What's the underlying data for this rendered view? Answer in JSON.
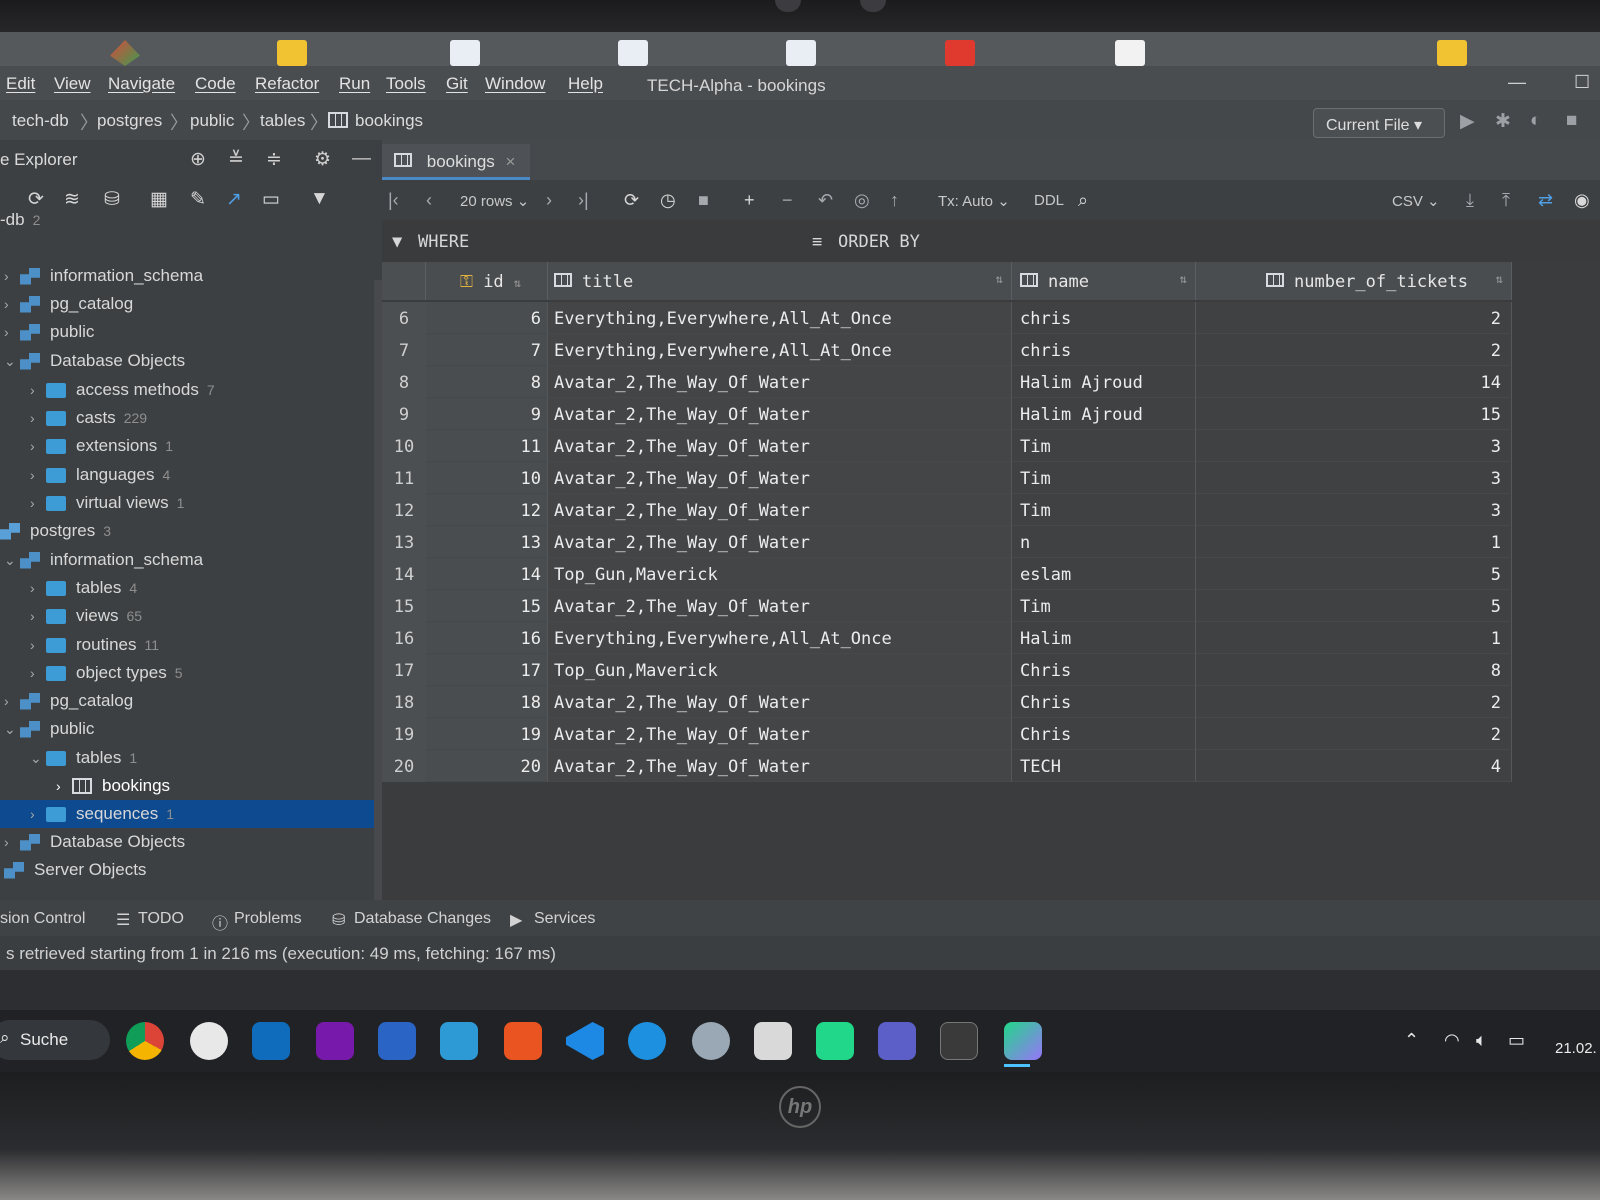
{
  "window": {
    "title": "TECH-Alpha - bookings",
    "minimize": "—",
    "maximize": "☐"
  },
  "menu": [
    "Edit",
    "View",
    "Navigate",
    "Code",
    "Refactor",
    "Run",
    "Tools",
    "Git",
    "Window",
    "Help"
  ],
  "breadcrumb": [
    "tech-db",
    "postgres",
    "public",
    "tables",
    "bookings"
  ],
  "run_config": "Current File",
  "explorer": {
    "title": "e Explorer",
    "tree": [
      {
        "label": "-db",
        "count": "2",
        "icon": "db-icon"
      },
      {
        "label": "information_schema",
        "count": "",
        "icon": "schema-icon"
      },
      {
        "label": "pg_catalog",
        "count": "",
        "icon": "schema-icon"
      },
      {
        "label": "public",
        "count": "",
        "icon": "schema-icon"
      },
      {
        "label": "Database Objects",
        "count": "",
        "icon": "schema-icon"
      },
      {
        "label": "access methods",
        "count": "7",
        "icon": "folder-icon"
      },
      {
        "label": "casts",
        "count": "229",
        "icon": "folder-icon"
      },
      {
        "label": "extensions",
        "count": "1",
        "icon": "folder-icon"
      },
      {
        "label": "languages",
        "count": "4",
        "icon": "folder-icon"
      },
      {
        "label": "virtual views",
        "count": "1",
        "icon": "folder-icon"
      },
      {
        "label": "postgres",
        "count": "3",
        "icon": "db-icon"
      },
      {
        "label": "information_schema",
        "count": "",
        "icon": "schema-icon"
      },
      {
        "label": "tables",
        "count": "4",
        "icon": "folder-icon"
      },
      {
        "label": "views",
        "count": "65",
        "icon": "folder-icon"
      },
      {
        "label": "routines",
        "count": "11",
        "icon": "folder-icon"
      },
      {
        "label": "object types",
        "count": "5",
        "icon": "folder-icon"
      },
      {
        "label": "pg_catalog",
        "count": "",
        "icon": "schema-icon"
      },
      {
        "label": "public",
        "count": "",
        "icon": "schema-icon"
      },
      {
        "label": "tables",
        "count": "1",
        "icon": "folder-icon"
      },
      {
        "label": "bookings",
        "count": "",
        "icon": "table-icon"
      },
      {
        "label": "sequences",
        "count": "1",
        "icon": "folder-icon"
      },
      {
        "label": "Database Objects",
        "count": "",
        "icon": "schema-icon"
      },
      {
        "label": "Server Objects",
        "count": "",
        "icon": "schema-icon"
      }
    ]
  },
  "editor": {
    "tab_label": "bookings",
    "page_size": "20 rows",
    "tx_mode": "Tx: Auto",
    "ddl_label": "DDL",
    "export_format": "CSV",
    "where_label": "WHERE",
    "order_label": "ORDER BY",
    "columns": [
      "id",
      "title",
      "name",
      "number_of_tickets"
    ],
    "rows": [
      {
        "n": "6",
        "id": "6",
        "title": "Everything,Everywhere,All_At_Once",
        "name": "chris",
        "tickets": "2"
      },
      {
        "n": "7",
        "id": "7",
        "title": "Everything,Everywhere,All_At_Once",
        "name": "chris",
        "tickets": "2"
      },
      {
        "n": "8",
        "id": "8",
        "title": "Avatar_2,The_Way_Of_Water",
        "name": "Halim Ajroud",
        "tickets": "14"
      },
      {
        "n": "9",
        "id": "9",
        "title": "Avatar_2,The_Way_Of_Water",
        "name": "Halim Ajroud",
        "tickets": "15"
      },
      {
        "n": "10",
        "id": "11",
        "title": "Avatar_2,The_Way_Of_Water",
        "name": "Tim",
        "tickets": "3"
      },
      {
        "n": "11",
        "id": "10",
        "title": "Avatar_2,The_Way_Of_Water",
        "name": "Tim",
        "tickets": "3"
      },
      {
        "n": "12",
        "id": "12",
        "title": "Avatar_2,The_Way_Of_Water",
        "name": "Tim",
        "tickets": "3"
      },
      {
        "n": "13",
        "id": "13",
        "title": "Avatar_2,The_Way_Of_Water",
        "name": "n",
        "tickets": "1"
      },
      {
        "n": "14",
        "id": "14",
        "title": "Top_Gun,Maverick",
        "name": "eslam",
        "tickets": "5"
      },
      {
        "n": "15",
        "id": "15",
        "title": "Avatar_2,The_Way_Of_Water",
        "name": "Tim",
        "tickets": "5"
      },
      {
        "n": "16",
        "id": "16",
        "title": "Everything,Everywhere,All_At_Once",
        "name": "Halim",
        "tickets": "1"
      },
      {
        "n": "17",
        "id": "17",
        "title": "Top_Gun,Maverick",
        "name": "Chris",
        "tickets": "8"
      },
      {
        "n": "18",
        "id": "18",
        "title": "Avatar_2,The_Way_Of_Water",
        "name": "Chris",
        "tickets": "2"
      },
      {
        "n": "19",
        "id": "19",
        "title": "Avatar_2,The_Way_Of_Water",
        "name": "Chris",
        "tickets": "2"
      },
      {
        "n": "20",
        "id": "20",
        "title": "Avatar_2,The_Way_Of_Water",
        "name": "TECH",
        "tickets": "4"
      }
    ]
  },
  "bottom_tabs": [
    "sion Control",
    "TODO",
    "Problems",
    "Database Changes",
    "Services"
  ],
  "status": "s retrieved starting from 1 in 216 ms (execution: 49 ms, fetching: 167 ms)",
  "taskbar": {
    "search": "Suche",
    "date": "21.02."
  },
  "colors": {
    "selection": "#0d4a8f",
    "accent": "#4a88c7",
    "folder": "#3d9bd6"
  }
}
